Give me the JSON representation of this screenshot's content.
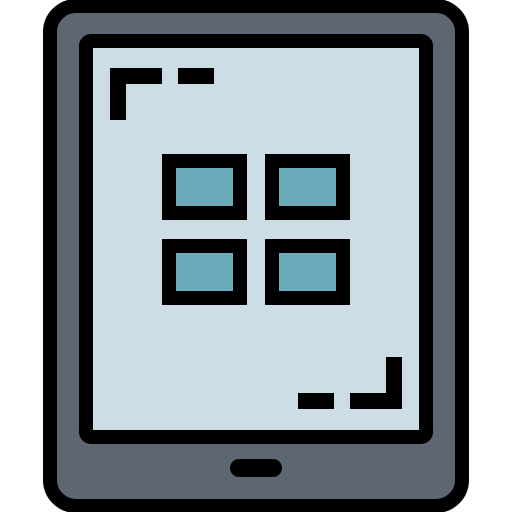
{
  "icon": {
    "name": "tablet-app-grid-icon",
    "colors": {
      "outline": "#000000",
      "body": "#5f6673",
      "screen": "#cddde6",
      "tile": "#6aaab9",
      "background": "#ffffff"
    }
  },
  "screen": {
    "grid": {
      "rows": 2,
      "columns": 2,
      "tiles": [
        {
          "name": "app-tile-top-left-icon"
        },
        {
          "name": "app-tile-top-right-icon"
        },
        {
          "name": "app-tile-bottom-left-icon"
        },
        {
          "name": "app-tile-bottom-right-icon"
        }
      ]
    },
    "corner_marks": [
      "top-left-corner-bracket-icon",
      "bottom-right-corner-bracket-icon"
    ]
  },
  "device": {
    "home_button": "home-button-icon"
  }
}
